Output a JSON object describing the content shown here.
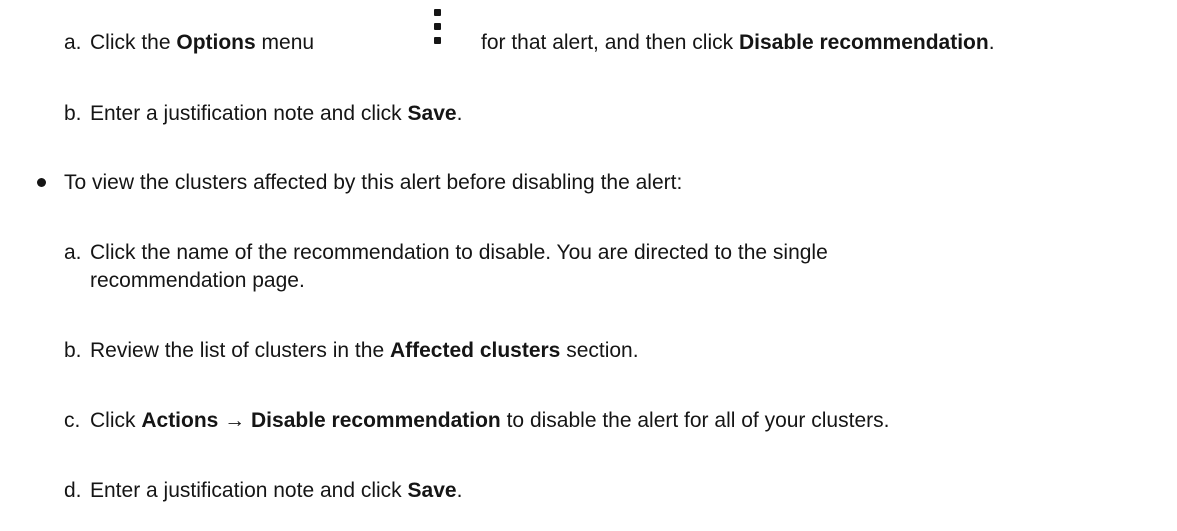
{
  "step_a1": {
    "marker": "a.",
    "pre": "Click the ",
    "bold1": "Options",
    "mid": " menu",
    "post": " for that alert, and then click ",
    "bold2": "Disable recommendation",
    "end": "."
  },
  "step_b1": {
    "marker": "b.",
    "pre": "Enter a justification note and click ",
    "bold": "Save",
    "end": "."
  },
  "bullet_text": "To view the clusters affected by this alert before disabling the alert:",
  "step_a2": {
    "marker": "a.",
    "line1": "Click the name of the recommendation to disable. You are directed to the single",
    "line2": "recommendation page."
  },
  "step_b2": {
    "marker": "b.",
    "pre": "Review the list of clusters in the ",
    "bold": "Affected clusters",
    "post": " section."
  },
  "step_c2": {
    "marker": "c.",
    "pre": "Click ",
    "bold": "Actions → Disable recommendation",
    "post": " to disable the alert for all of your clusters."
  },
  "step_d2": {
    "marker": "d.",
    "pre": "Enter a justification note and click ",
    "bold": "Save",
    "end": "."
  },
  "icons": {
    "options_menu": "kebab-icon",
    "list_bullet": "bullet-icon"
  }
}
